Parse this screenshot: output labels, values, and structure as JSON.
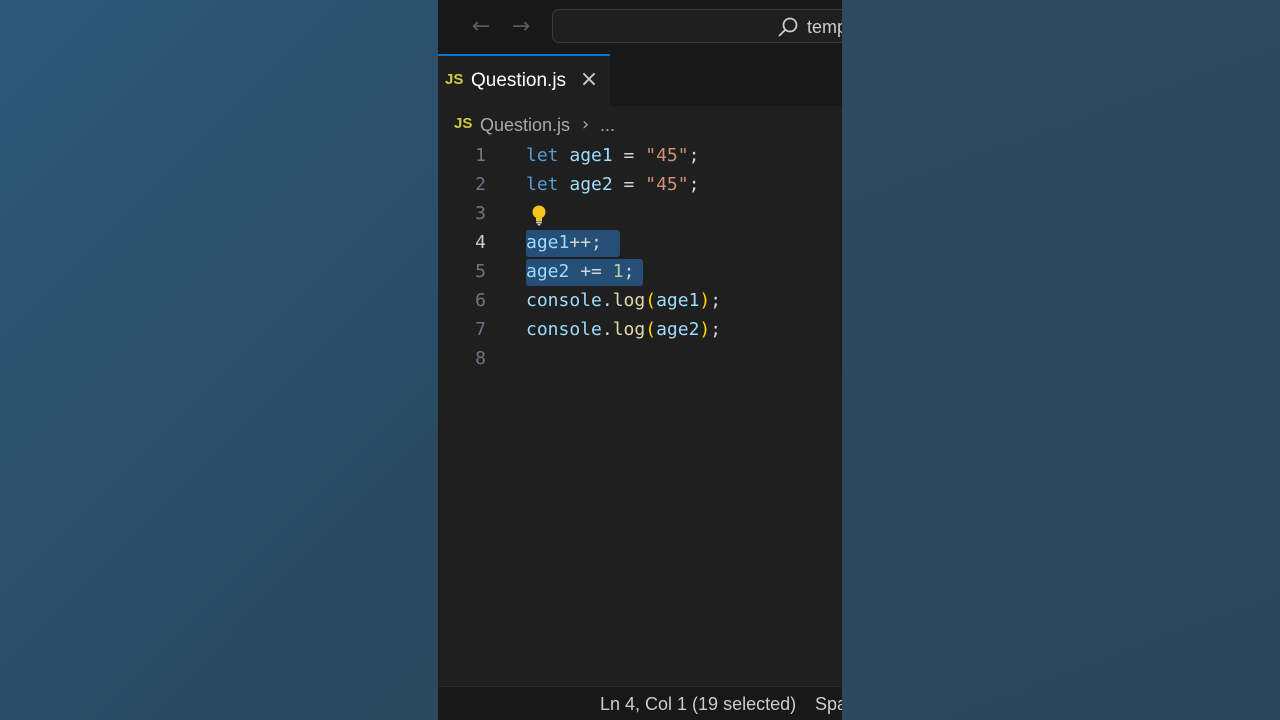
{
  "titlebar": {
    "search_text": "temp"
  },
  "tab": {
    "badge": "JS",
    "label": "Question.js",
    "close": "×"
  },
  "breadcrumb": {
    "badge": "JS",
    "file": "Question.js",
    "separator": "›",
    "more": "..."
  },
  "editor": {
    "active_line": 4,
    "lines": [
      {
        "number": "1",
        "tokens": [
          [
            "kw",
            "let"
          ],
          [
            "op",
            " "
          ],
          [
            "var",
            "age1"
          ],
          [
            "op",
            " = "
          ],
          [
            "str",
            "\"45\""
          ],
          [
            "op",
            ";"
          ]
        ]
      },
      {
        "number": "2",
        "tokens": [
          [
            "kw",
            "let"
          ],
          [
            "op",
            " "
          ],
          [
            "var",
            "age2"
          ],
          [
            "op",
            " = "
          ],
          [
            "str",
            "\"45\""
          ],
          [
            "op",
            ";"
          ]
        ]
      },
      {
        "number": "3",
        "tokens": []
      },
      {
        "number": "4",
        "tokens": [
          [
            "var",
            "age1"
          ],
          [
            "op",
            "++;"
          ]
        ]
      },
      {
        "number": "5",
        "tokens": [
          [
            "var",
            "age2"
          ],
          [
            "op",
            " += "
          ],
          [
            "num",
            "1"
          ],
          [
            "op",
            ";"
          ]
        ]
      },
      {
        "number": "6",
        "tokens": [
          [
            "var",
            "console"
          ],
          [
            "op",
            "."
          ],
          [
            "fn",
            "log"
          ],
          [
            "paren",
            "("
          ],
          [
            "var",
            "age1"
          ],
          [
            "paren",
            ")"
          ],
          [
            "op",
            ";"
          ]
        ]
      },
      {
        "number": "7",
        "tokens": [
          [
            "var",
            "console"
          ],
          [
            "op",
            "."
          ],
          [
            "fn",
            "log"
          ],
          [
            "paren",
            "("
          ],
          [
            "var",
            "age2"
          ],
          [
            "paren",
            ")"
          ],
          [
            "op",
            ";"
          ]
        ]
      },
      {
        "number": "8",
        "tokens": []
      }
    ]
  },
  "statusbar": {
    "position": "Ln 4, Col 1 (19 selected)",
    "spaces": "Spa"
  },
  "colors": {
    "keyword": "#569cd6",
    "variable": "#9cdcfe",
    "string": "#ce9178",
    "number": "#b5cea8",
    "function": "#dcdcaa",
    "selection": "#264f78",
    "accent": "#0078d4",
    "js_badge": "#cbcb41"
  }
}
